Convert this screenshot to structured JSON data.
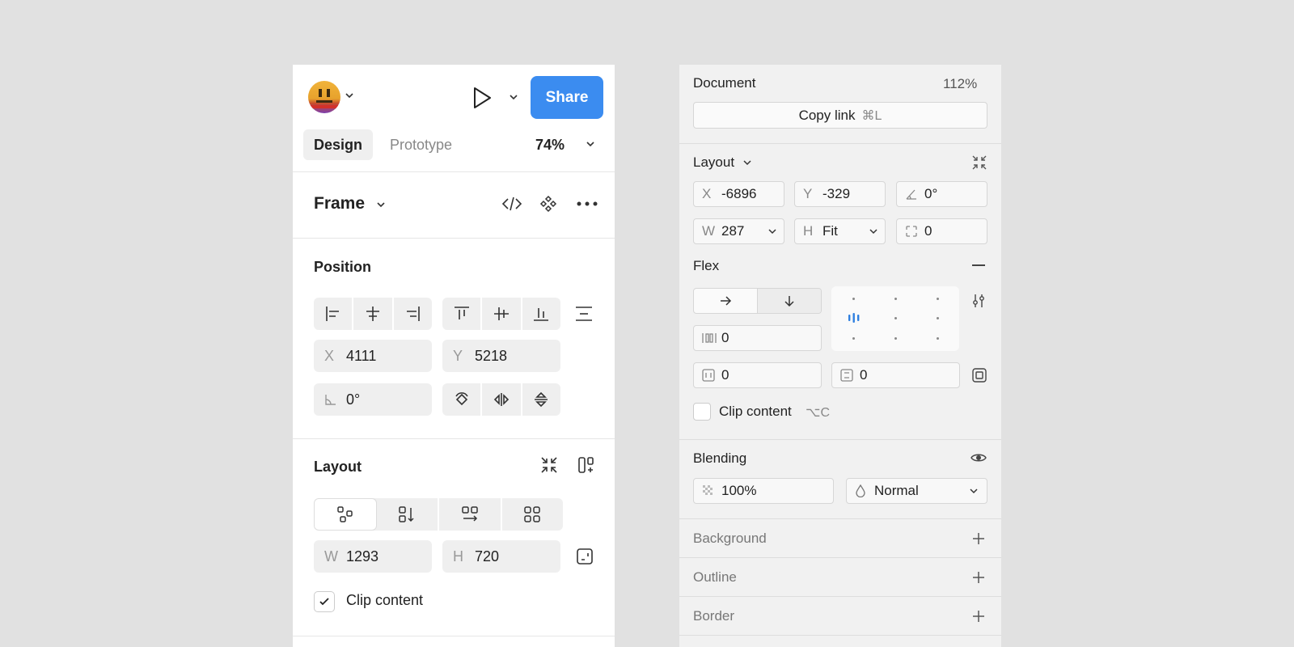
{
  "left_panel": {
    "share_label": "Share",
    "tabs": {
      "design": "Design",
      "prototype": "Prototype"
    },
    "zoom": "74%",
    "frame": {
      "title": "Frame"
    },
    "position": {
      "title": "Position",
      "x_label": "X",
      "x_value": "4111",
      "y_label": "Y",
      "y_value": "5218",
      "rotation": "0°"
    },
    "layout": {
      "title": "Layout",
      "w_label": "W",
      "w_value": "1293",
      "h_label": "H",
      "h_value": "720",
      "clip_label": "Clip content"
    }
  },
  "right_panel": {
    "document": {
      "title": "Document",
      "zoom": "112%",
      "copy_link": "Copy link",
      "copy_shortcut": "⌘L"
    },
    "layout": {
      "title": "Layout",
      "x_label": "X",
      "x_value": "-6896",
      "y_label": "Y",
      "y_value": "-329",
      "rotation": "0°",
      "w_label": "W",
      "w_value": "287",
      "h_label": "H",
      "h_value": "Fit",
      "radius": "0"
    },
    "flex": {
      "title": "Flex",
      "gap": "0",
      "padding_h": "0",
      "padding_v": "0",
      "clip_label": "Clip content",
      "clip_shortcut": "⌥C"
    },
    "blending": {
      "title": "Blending",
      "opacity": "100%",
      "mode": "Normal"
    },
    "sections": [
      "Background",
      "Outline",
      "Border"
    ]
  }
}
